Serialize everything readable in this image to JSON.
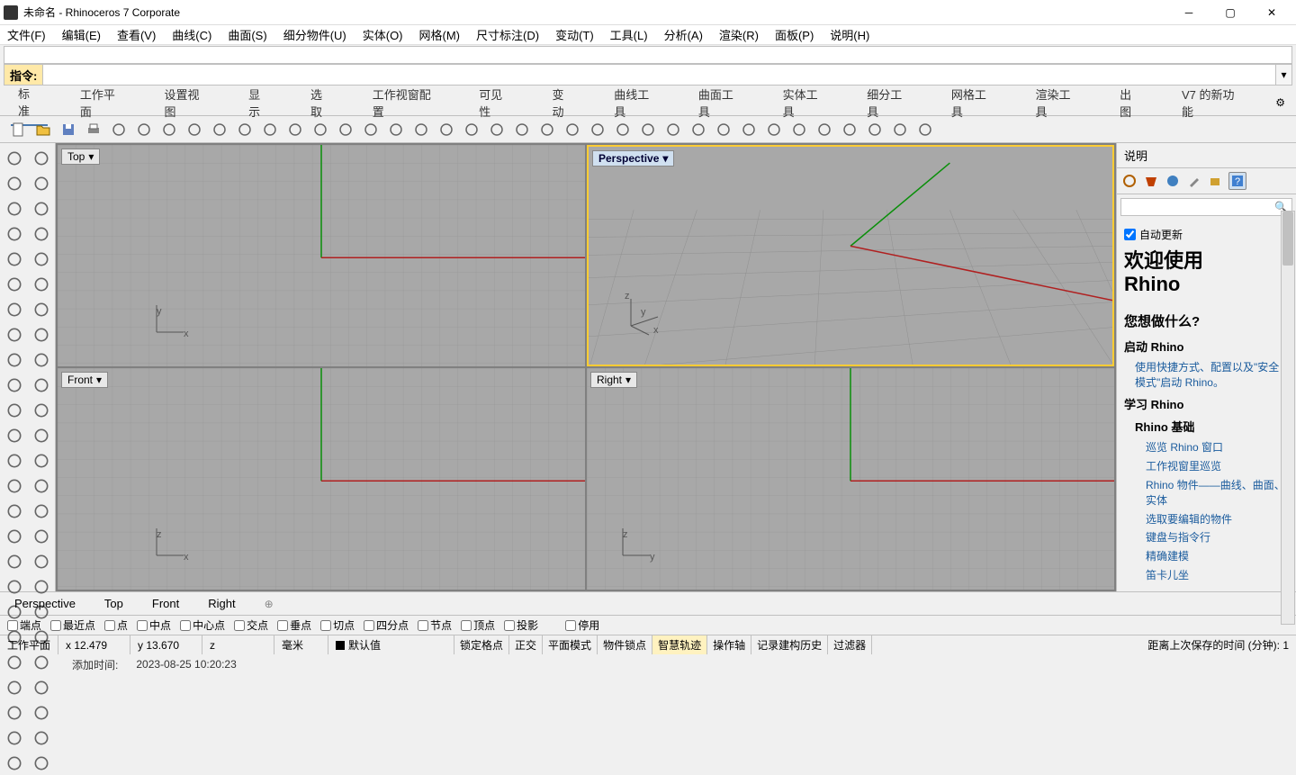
{
  "window": {
    "title": "未命名 - Rhinoceros 7 Corporate"
  },
  "menu": [
    "文件(F)",
    "编辑(E)",
    "查看(V)",
    "曲线(C)",
    "曲面(S)",
    "细分物件(U)",
    "实体(O)",
    "网格(M)",
    "尺寸标注(D)",
    "变动(T)",
    "工具(L)",
    "分析(A)",
    "渲染(R)",
    "面板(P)",
    "说明(H)"
  ],
  "cmd": {
    "label": "指令:"
  },
  "tabs": [
    "标准",
    "工作平面",
    "设置视图",
    "显示",
    "选取",
    "工作视窗配置",
    "可见性",
    "变动",
    "曲线工具",
    "曲面工具",
    "实体工具",
    "细分工具",
    "网格工具",
    "渲染工具",
    "出图",
    "V7 的新功能"
  ],
  "toolbar_icons": [
    "new",
    "open",
    "save",
    "print",
    "properties",
    "cut",
    "copy",
    "paste",
    "undo",
    "redo",
    "pan",
    "rotate-view",
    "zoom-win",
    "zoom-ext",
    "zoom-sel",
    "undo-view",
    "redo-view",
    "4view",
    "named-views",
    "named-pos",
    "cplane",
    "layer",
    "sel-filter",
    "visibility",
    "shade",
    "render",
    "render-prev",
    "material",
    "light",
    "env",
    "ground",
    "named-view2",
    "sun",
    "options",
    "obj-prop",
    "record",
    "help"
  ],
  "side_icons": [
    "select",
    "lasso",
    "polyline",
    "spline",
    "circle",
    "ellipse",
    "arc",
    "rect",
    "polygon",
    "curve-tools",
    "point",
    "text",
    "surface-corner",
    "surface-edge",
    "extrude",
    "loft",
    "sweep",
    "revolve",
    "box",
    "sphere",
    "cylinder",
    "cone",
    "torus",
    "ellipsoid",
    "subd-box",
    "pipe",
    "gear",
    "mesh",
    "offset",
    "fillet",
    "boolean",
    "trim",
    "split",
    "join",
    "explode",
    "group",
    "ungroup",
    "move",
    "rotate",
    "scale",
    "mirror",
    "array",
    "align",
    "dim",
    "hatch",
    "hatch2",
    "check",
    "analyze",
    "layer",
    "properties"
  ],
  "viewports": {
    "top": "Top",
    "perspective": "Perspective",
    "front": "Front",
    "right": "Right"
  },
  "vp_tabs": [
    "Perspective",
    "Top",
    "Front",
    "Right"
  ],
  "right_panel": {
    "title": "说明",
    "auto_update": "自动更新",
    "welcome": "欢迎使用\nRhino",
    "question": "您想做什么?",
    "start_h": "启动 Rhino",
    "start_link": "使用快捷方式、配置以及\"安全模式\"启动 Rhino。",
    "learn_h": "学习 Rhino",
    "basics_h": "Rhino 基础",
    "links": [
      "巡览 Rhino 窗口",
      "工作视窗里巡览",
      "Rhino 物件——曲线、曲面、实体",
      "选取要编辑的物件",
      "键盘与指令行",
      "精确建模",
      "    笛卡儿坐"
    ]
  },
  "osnap": [
    "端点",
    "最近点",
    "点",
    "中点",
    "中心点",
    "交点",
    "垂点",
    "切点",
    "四分点",
    "节点",
    "顶点",
    "投影"
  ],
  "osnap_disable": "停用",
  "status": {
    "cplane": "工作平面",
    "x": "x 12.479",
    "y": "y 13.670",
    "z": "z",
    "unit": "毫米",
    "layer": "默认值",
    "toggles": [
      "锁定格点",
      "正交",
      "平面模式",
      "物件锁点",
      "智慧轨迹",
      "操作轴",
      "记录建构历史",
      "过滤器"
    ],
    "active_toggle": 4,
    "time": "距离上次保存的时间 (分钟): 1"
  },
  "footer": {
    "added": "添加时间:",
    "date": "2023-08-25 10:20:23"
  }
}
